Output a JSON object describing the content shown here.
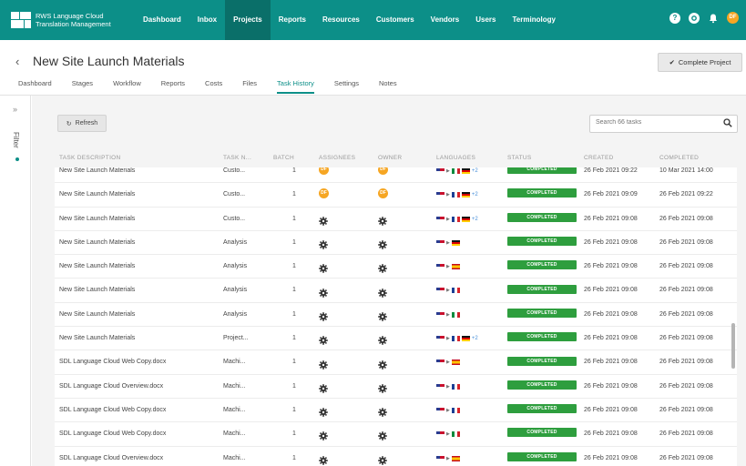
{
  "app": {
    "logo_line1": "RWS Language Cloud",
    "logo_line2": "Translation Management",
    "brand_color": "#0c8f88",
    "nav": [
      {
        "label": "Dashboard",
        "active": false
      },
      {
        "label": "Inbox",
        "active": false
      },
      {
        "label": "Projects",
        "active": true
      },
      {
        "label": "Reports",
        "active": false
      },
      {
        "label": "Resources",
        "active": false
      },
      {
        "label": "Customers",
        "active": false
      },
      {
        "label": "Vendors",
        "active": false
      },
      {
        "label": "Users",
        "active": false
      },
      {
        "label": "Terminology",
        "active": false
      }
    ],
    "top_icons": {
      "help": "?",
      "user_initials": "DF"
    }
  },
  "project": {
    "back_glyph": "‹",
    "title": "New Site Launch Materials",
    "complete_label": "Complete Project",
    "tabs": [
      {
        "label": "Dashboard",
        "active": false
      },
      {
        "label": "Stages",
        "active": false
      },
      {
        "label": "Workflow",
        "active": false
      },
      {
        "label": "Reports",
        "active": false
      },
      {
        "label": "Costs",
        "active": false
      },
      {
        "label": "Files",
        "active": false
      },
      {
        "label": "Task History",
        "active": true
      },
      {
        "label": "Settings",
        "active": false
      },
      {
        "label": "Notes",
        "active": false
      }
    ]
  },
  "filter": {
    "label": "Filter"
  },
  "toolbar": {
    "refresh_label": "Refresh",
    "search_placeholder": "Search 66 tasks"
  },
  "table": {
    "headers": {
      "desc": "TASK DESCRIPTION",
      "type": "TASK N...",
      "batch": "BATCH",
      "assignees": "ASSIGNEES",
      "owner": "OWNER",
      "languages": "LANGUAGES",
      "status": "STATUS",
      "created": "CREATED",
      "completed": "COMPLETED"
    },
    "rows": [
      {
        "desc": "New Site Launch Materials",
        "type": "Custo...",
        "batch": "1",
        "assignee": "avatar",
        "owner": "avatar",
        "src": "us",
        "targets": [
          "it",
          "de"
        ],
        "plus": "+2",
        "status": "COMPLETED",
        "created": "26 Feb 2021 09:22",
        "completed": "10 Mar 2021 14:00"
      },
      {
        "desc": "New Site Launch Materials",
        "type": "Custo...",
        "batch": "1",
        "assignee": "avatar",
        "owner": "avatar",
        "src": "us",
        "targets": [
          "fr",
          "de"
        ],
        "plus": "+2",
        "status": "COMPLETED",
        "created": "26 Feb 2021 09:09",
        "completed": "26 Feb 2021 09:22"
      },
      {
        "desc": "New Site Launch Materials",
        "type": "Custo...",
        "batch": "1",
        "assignee": "gear",
        "owner": "gear",
        "src": "us",
        "targets": [
          "fr",
          "de"
        ],
        "plus": "+2",
        "status": "COMPLETED",
        "created": "26 Feb 2021 09:08",
        "completed": "26 Feb 2021 09:08"
      },
      {
        "desc": "New Site Launch Materials",
        "type": "Analysis",
        "batch": "1",
        "assignee": "gear",
        "owner": "gear",
        "src": "us",
        "targets": [
          "de"
        ],
        "plus": "",
        "status": "COMPLETED",
        "created": "26 Feb 2021 09:08",
        "completed": "26 Feb 2021 09:08"
      },
      {
        "desc": "New Site Launch Materials",
        "type": "Analysis",
        "batch": "1",
        "assignee": "gear",
        "owner": "gear",
        "src": "us",
        "targets": [
          "es"
        ],
        "plus": "",
        "status": "COMPLETED",
        "created": "26 Feb 2021 09:08",
        "completed": "26 Feb 2021 09:08"
      },
      {
        "desc": "New Site Launch Materials",
        "type": "Analysis",
        "batch": "1",
        "assignee": "gear",
        "owner": "gear",
        "src": "us",
        "targets": [
          "fr"
        ],
        "plus": "",
        "status": "COMPLETED",
        "created": "26 Feb 2021 09:08",
        "completed": "26 Feb 2021 09:08"
      },
      {
        "desc": "New Site Launch Materials",
        "type": "Analysis",
        "batch": "1",
        "assignee": "gear",
        "owner": "gear",
        "src": "us",
        "targets": [
          "it"
        ],
        "plus": "",
        "status": "COMPLETED",
        "created": "26 Feb 2021 09:08",
        "completed": "26 Feb 2021 09:08"
      },
      {
        "desc": "New Site Launch Materials",
        "type": "Project...",
        "batch": "1",
        "assignee": "gear",
        "owner": "gear",
        "src": "us",
        "targets": [
          "fr",
          "de"
        ],
        "plus": "+2",
        "status": "COMPLETED",
        "created": "26 Feb 2021 09:08",
        "completed": "26 Feb 2021 09:08"
      },
      {
        "desc": "SDL Language Cloud Web Copy.docx",
        "type": "Machi...",
        "batch": "1",
        "assignee": "gear",
        "owner": "gear",
        "src": "us",
        "targets": [
          "es"
        ],
        "plus": "",
        "status": "COMPLETED",
        "created": "26 Feb 2021 09:08",
        "completed": "26 Feb 2021 09:08"
      },
      {
        "desc": "SDL Language Cloud Overview.docx",
        "type": "Machi...",
        "batch": "1",
        "assignee": "gear",
        "owner": "gear",
        "src": "us",
        "targets": [
          "fr"
        ],
        "plus": "",
        "status": "COMPLETED",
        "created": "26 Feb 2021 09:08",
        "completed": "26 Feb 2021 09:08"
      },
      {
        "desc": "SDL Language Cloud Web Copy.docx",
        "type": "Machi...",
        "batch": "1",
        "assignee": "gear",
        "owner": "gear",
        "src": "us",
        "targets": [
          "fr"
        ],
        "plus": "",
        "status": "COMPLETED",
        "created": "26 Feb 2021 09:08",
        "completed": "26 Feb 2021 09:08"
      },
      {
        "desc": "SDL Language Cloud Web Copy.docx",
        "type": "Machi...",
        "batch": "1",
        "assignee": "gear",
        "owner": "gear",
        "src": "us",
        "targets": [
          "it"
        ],
        "plus": "",
        "status": "COMPLETED",
        "created": "26 Feb 2021 09:08",
        "completed": "26 Feb 2021 09:08"
      },
      {
        "desc": "SDL Language Cloud Overview.docx",
        "type": "Machi...",
        "batch": "1",
        "assignee": "gear",
        "owner": "gear",
        "src": "us",
        "targets": [
          "es"
        ],
        "plus": "",
        "status": "COMPLETED",
        "created": "26 Feb 2021 09:08",
        "completed": "26 Feb 2021 09:08"
      }
    ]
  },
  "colors": {
    "status_completed": "#2e9e3e",
    "avatar": "#f6a623"
  }
}
